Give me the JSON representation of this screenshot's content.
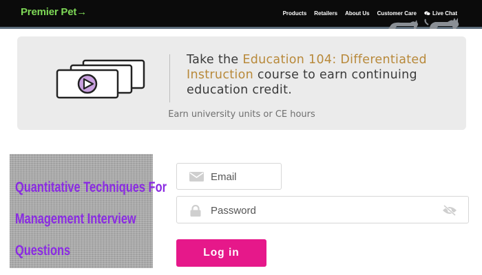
{
  "header": {
    "logo": "Premier Pet",
    "logo_suffix": "→",
    "nav": [
      "Products",
      "Retailers",
      "About Us",
      "Customer Care"
    ],
    "live_chat": "Live Chat"
  },
  "banner": {
    "headline_prefix": "Take the ",
    "course_name": "Education 104: Differentiated Instruction",
    "headline_suffix": " course to earn continuing education credit.",
    "subtext": "Earn university units or CE hours",
    "accent_color": "#b8893a"
  },
  "book_image": {
    "lines": [
      "Quantitative Techniques For",
      "Management Interview",
      "Questions"
    ],
    "text_color": "#8a2be2"
  },
  "login": {
    "email_placeholder": "Email",
    "password_placeholder": "Password",
    "button_label": "Log in",
    "button_color": "#e6188a"
  },
  "icons": [
    "chat-bubble-icon",
    "pets-silhouette-icon",
    "video-slides-icon",
    "envelope-icon",
    "lock-icon",
    "eye-slash-icon"
  ]
}
